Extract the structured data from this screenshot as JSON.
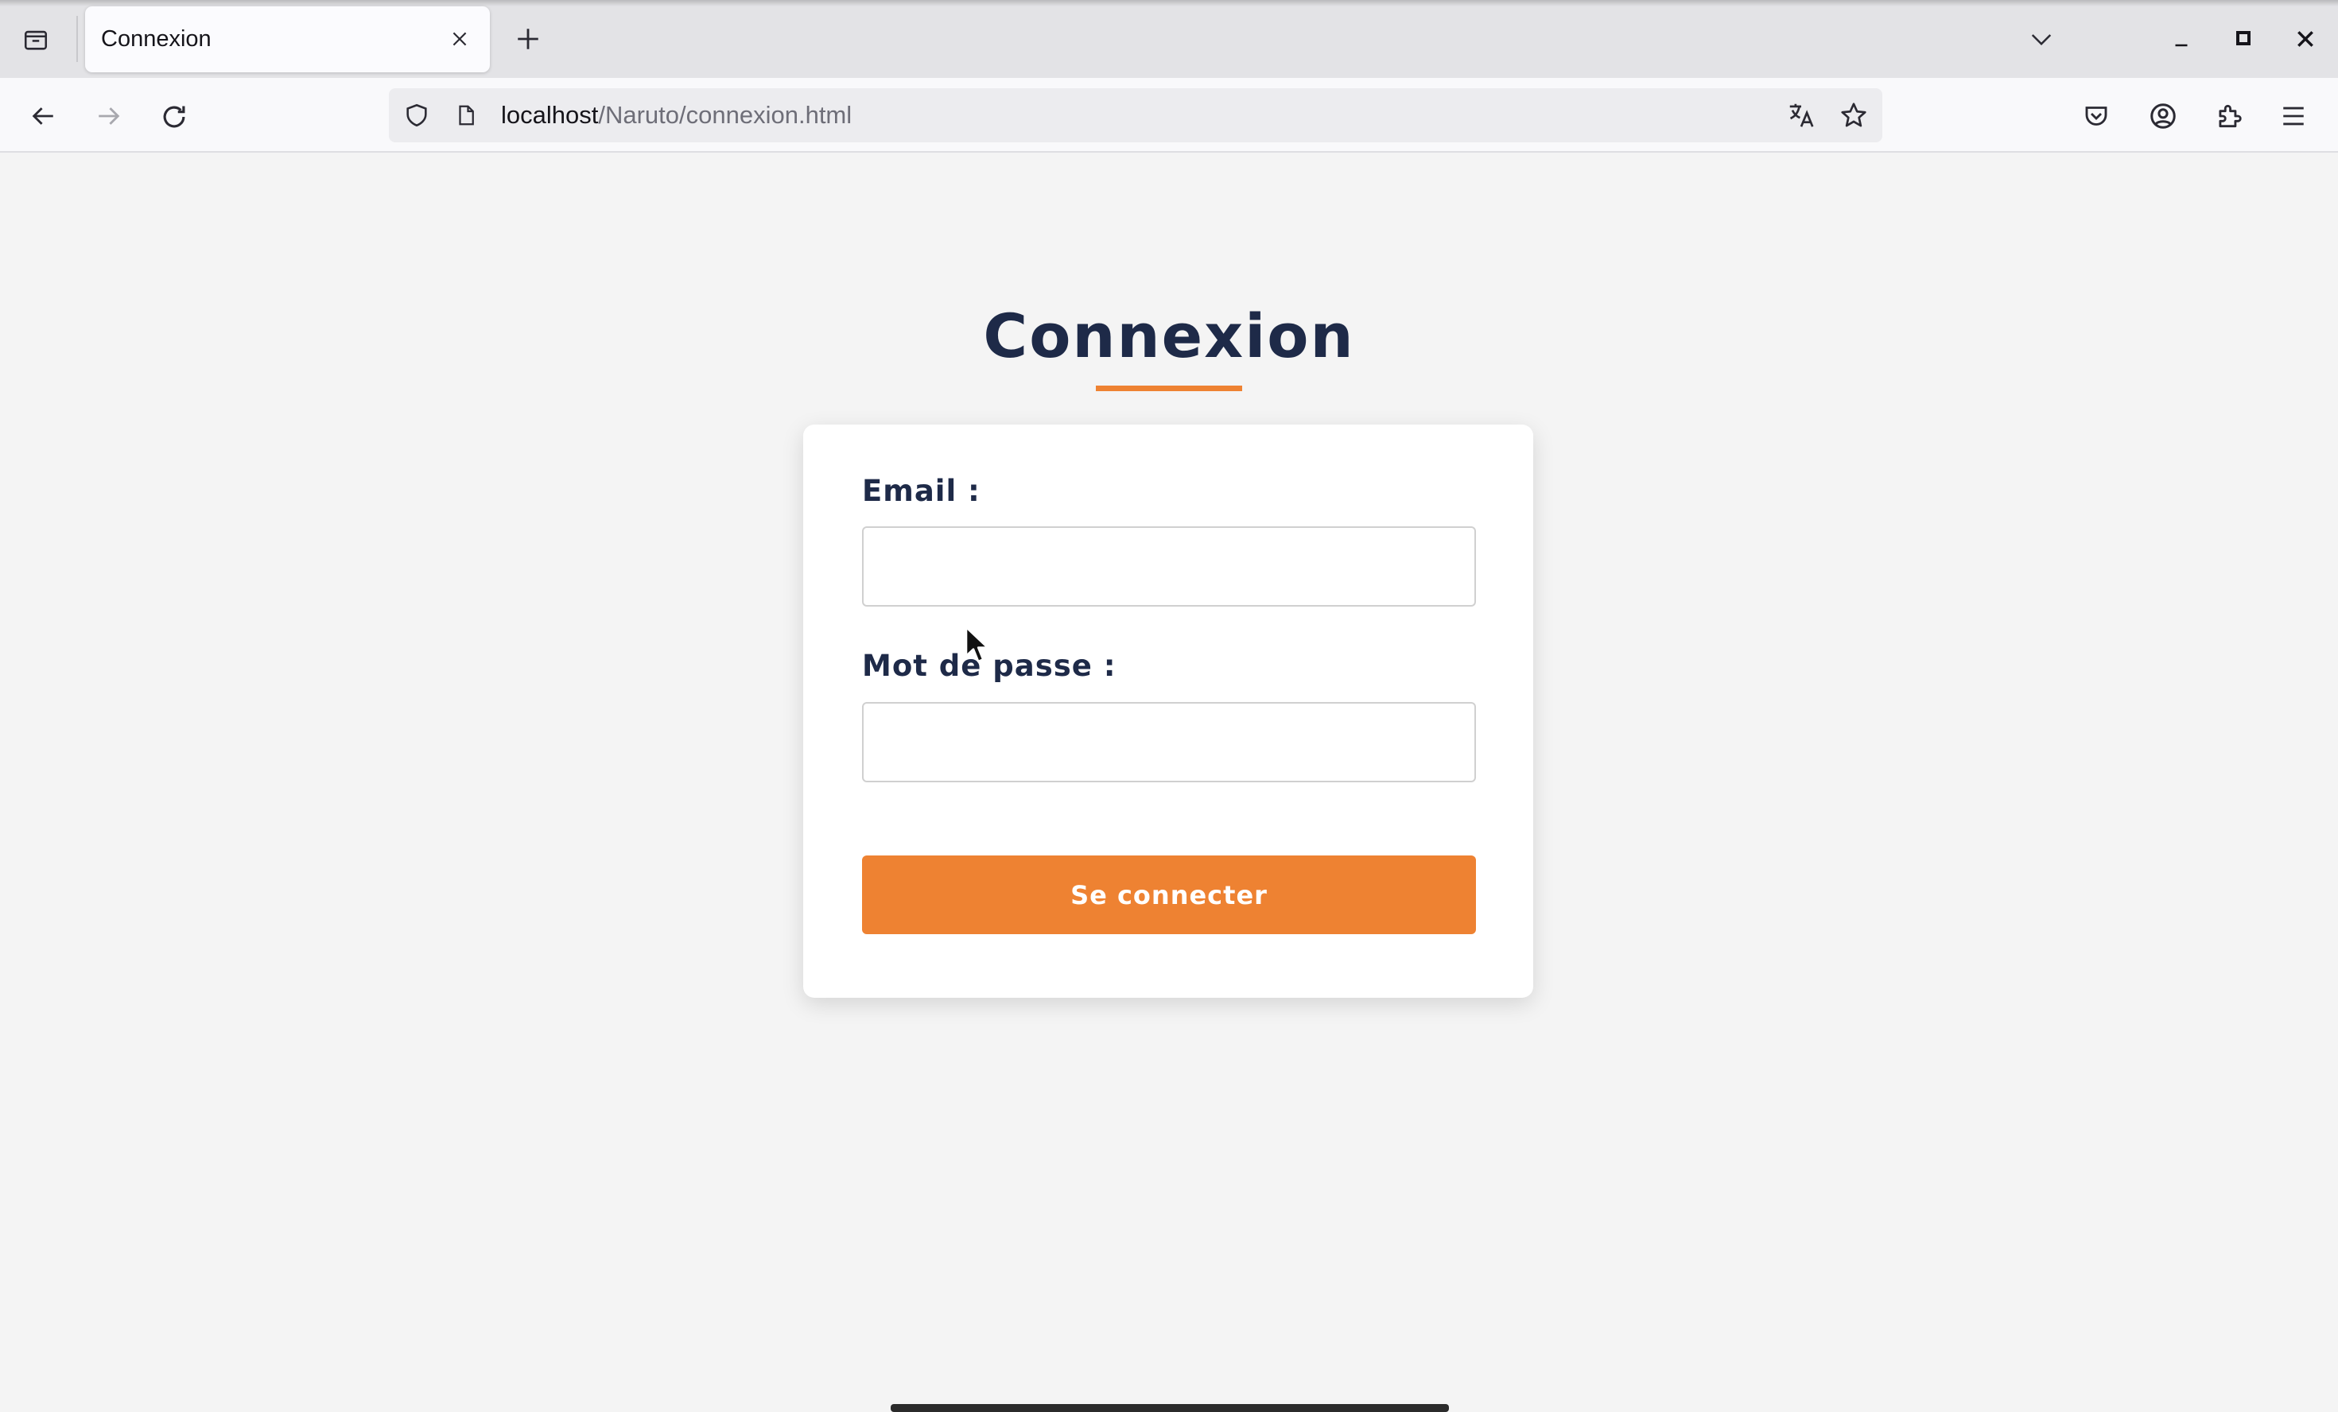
{
  "browser": {
    "tab": {
      "title": "Connexion"
    },
    "url": {
      "host": "localhost",
      "path": "/Naruto/connexion.html"
    }
  },
  "page": {
    "title": "Connexion",
    "form": {
      "email_label": "Email :",
      "email_value": "",
      "password_label": "Mot de passe :",
      "password_value": "",
      "submit_label": "Se connecter"
    }
  },
  "colors": {
    "accent": "#ee8232",
    "heading": "#1e2a48",
    "background": "#f4f4f4"
  }
}
